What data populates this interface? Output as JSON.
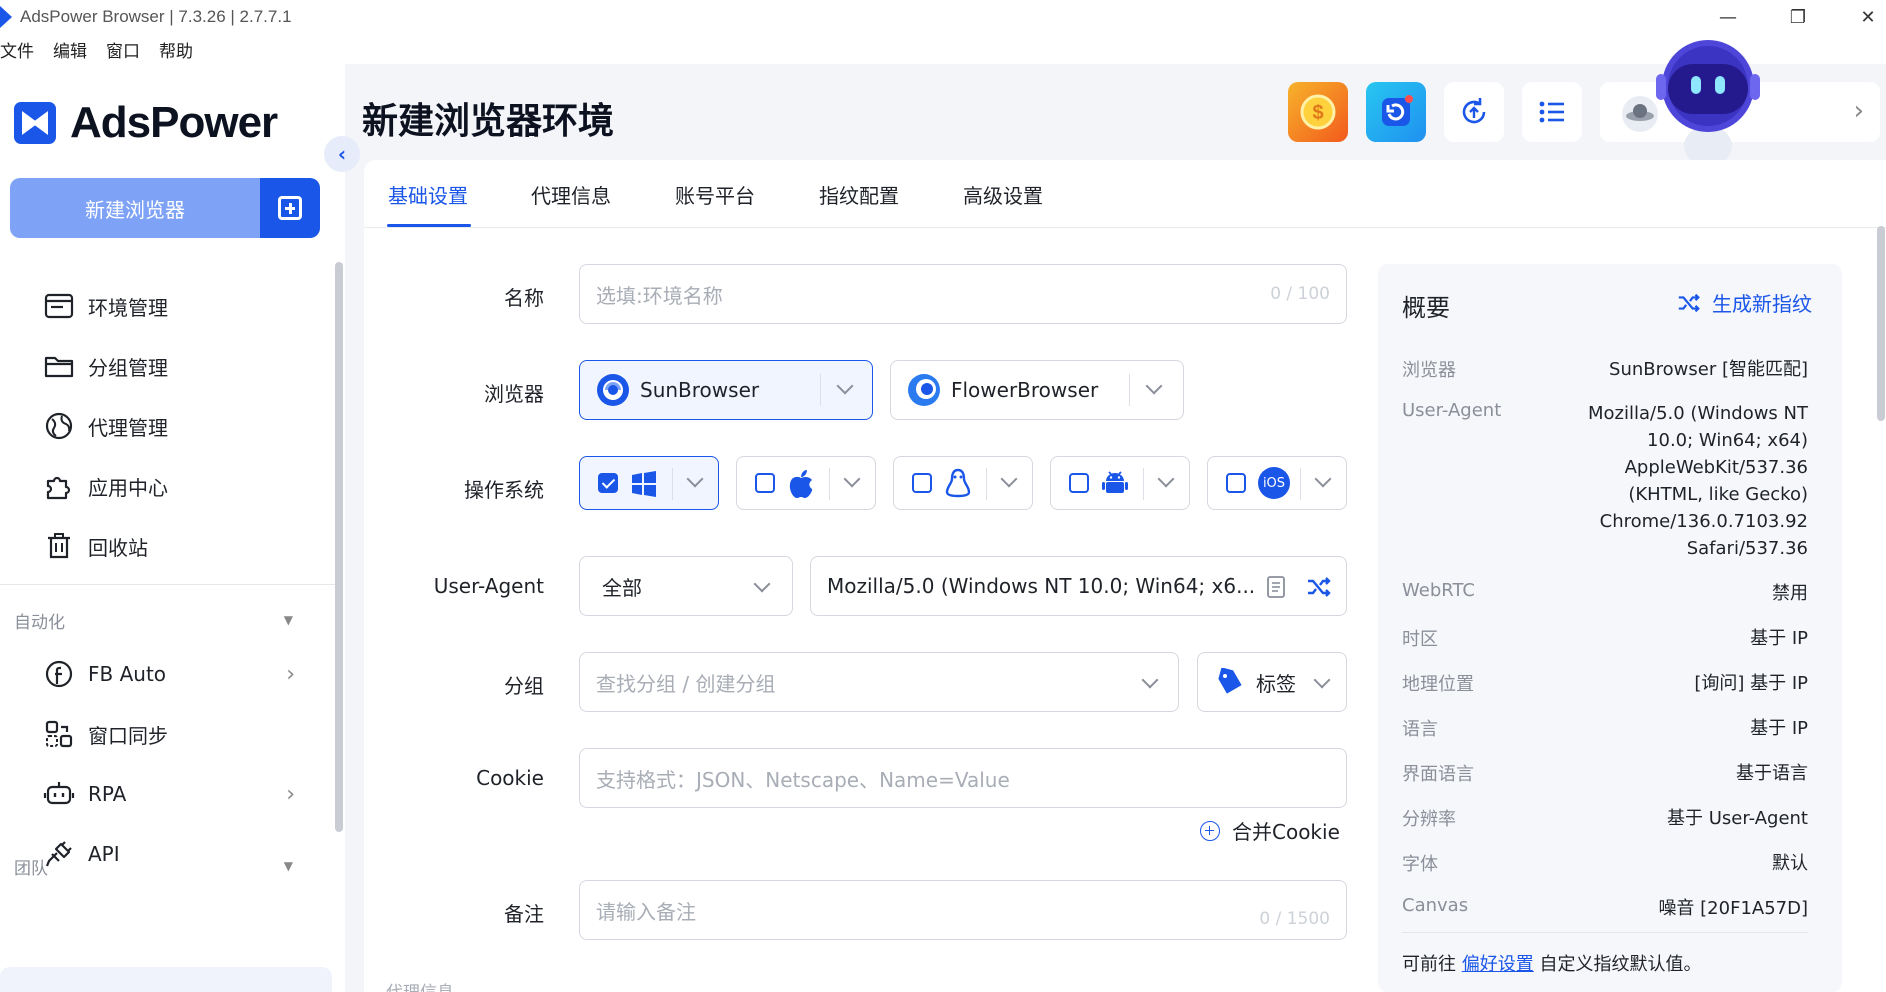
{
  "window": {
    "title": "AdsPower Browser | 7.3.26 | 2.7.7.1"
  },
  "menu": [
    "文件",
    "编辑",
    "窗口",
    "帮助"
  ],
  "brand": {
    "name": "AdsPower",
    "accent": "#1a56e8"
  },
  "sidebar": {
    "new_browser_label": "新建浏览器",
    "items": [
      {
        "label": "环境管理",
        "icon": "browser-window-icon"
      },
      {
        "label": "分组管理",
        "icon": "folder-icon"
      },
      {
        "label": "代理管理",
        "icon": "globe-icon"
      },
      {
        "label": "应用中心",
        "icon": "puzzle-icon"
      },
      {
        "label": "回收站",
        "icon": "trash-icon"
      }
    ],
    "automation_section": "自动化",
    "automation_items": [
      {
        "label": "FB Auto",
        "icon": "facebook-icon",
        "has_arrow": true
      },
      {
        "label": "窗口同步",
        "icon": "sync-windows-icon",
        "has_arrow": false
      },
      {
        "label": "RPA",
        "icon": "robot-icon",
        "has_arrow": true
      },
      {
        "label": "API",
        "icon": "plug-icon",
        "has_arrow": false
      }
    ],
    "team_section": "团队"
  },
  "header": {
    "title": "新建浏览器环境"
  },
  "tabs": [
    "基础设置",
    "代理信息",
    "账号平台",
    "指纹配置",
    "高级设置"
  ],
  "form": {
    "name": {
      "label": "名称",
      "placeholder": "选填:环境名称",
      "counter": "0 / 100"
    },
    "browser": {
      "label": "浏览器",
      "options": [
        "SunBrowser",
        "FlowerBrowser"
      ]
    },
    "os": {
      "label": "操作系统",
      "options": [
        "windows-icon",
        "apple-icon",
        "linux-icon",
        "android-icon",
        "ios-icon"
      ],
      "ios_text": "iOS"
    },
    "user_agent": {
      "label": "User-Agent",
      "select_value": "全部",
      "value": "Mozilla/5.0 (Windows NT 10.0; Win64; x6..."
    },
    "group": {
      "label": "分组",
      "placeholder": "查找分组 / 创建分组",
      "tag_label": "标签"
    },
    "cookie": {
      "label": "Cookie",
      "placeholder": "支持格式：JSON、Netscape、Name=Value",
      "merge_label": "合并Cookie"
    },
    "note": {
      "label": "备注",
      "placeholder": "请输入备注",
      "counter": "0 / 1500"
    },
    "next_section": "代理信息"
  },
  "overview": {
    "title": "概要",
    "generate_label": "生成新指纹",
    "rows": [
      {
        "k": "浏览器",
        "v": "SunBrowser [智能匹配]"
      },
      {
        "k": "User-Agent",
        "v": "Mozilla/5.0 (Windows NT\n10.0; Win64; x64)\nAppleWebKit/537.36\n(KHTML, like Gecko)\nChrome/136.0.7103.92\nSafari/537.36"
      },
      {
        "k": "WebRTC",
        "v": "禁用"
      },
      {
        "k": "时区",
        "v": "基于 IP"
      },
      {
        "k": "地理位置",
        "v": "[询问] 基于 IP"
      },
      {
        "k": "语言",
        "v": "基于 IP"
      },
      {
        "k": "界面语言",
        "v": "基于语言"
      },
      {
        "k": "分辨率",
        "v": "基于 User-Agent"
      },
      {
        "k": "字体",
        "v": "默认"
      },
      {
        "k": "Canvas",
        "v": "噪音 [20F1A57D]"
      }
    ],
    "footer_pre": "可前往 ",
    "footer_link": "偏好设置",
    "footer_post": " 自定义指纹默认值。"
  }
}
